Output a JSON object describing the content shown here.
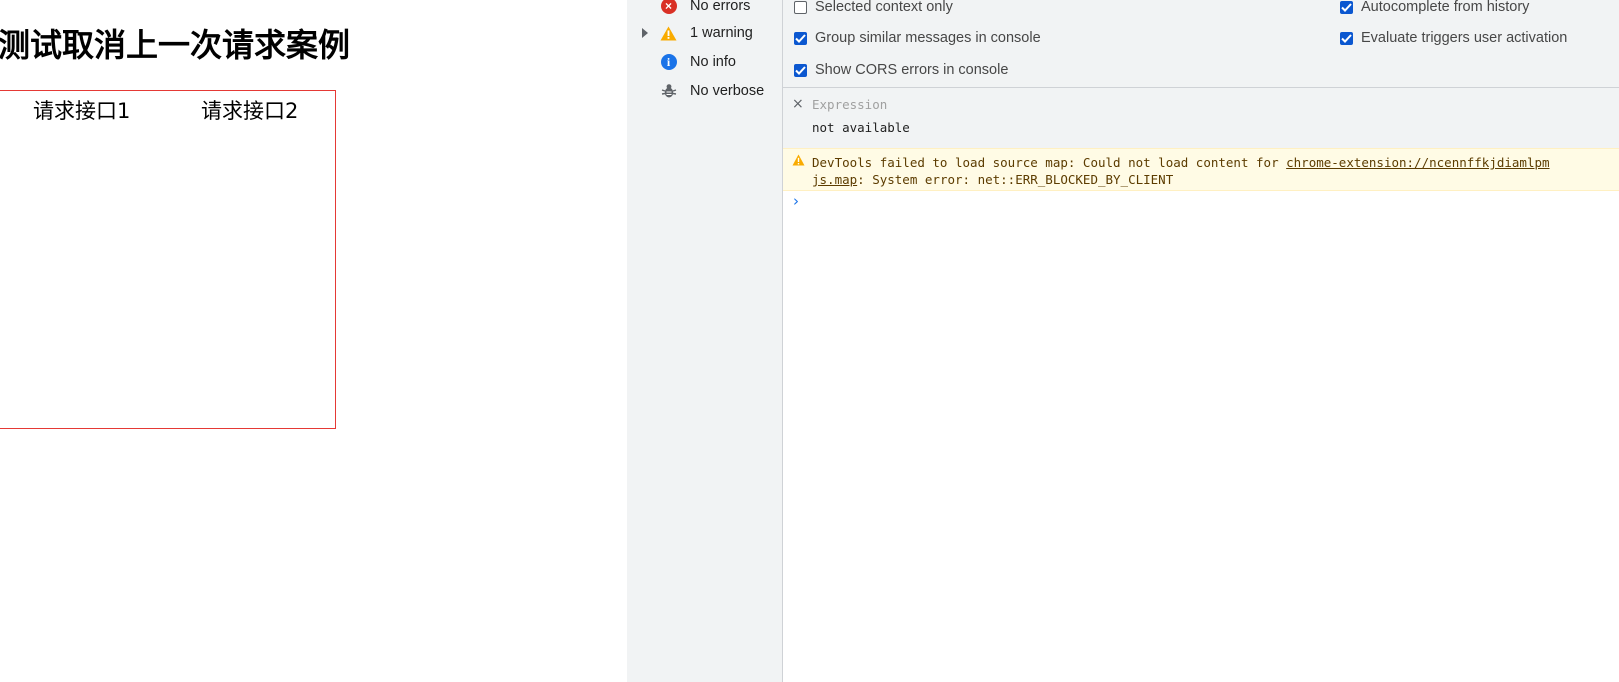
{
  "page": {
    "title": "测试取消上一次请求案例",
    "buttons": [
      "请求接口1",
      "请求接口2"
    ]
  },
  "devtools": {
    "sidebar": [
      {
        "label": "No errors",
        "icon": "error-icon"
      },
      {
        "label": "1 warning",
        "icon": "warning-icon"
      },
      {
        "label": "No info",
        "icon": "info-icon"
      },
      {
        "label": "No verbose",
        "icon": "bug-icon"
      }
    ],
    "settings": [
      {
        "label": "Selected context only",
        "checked": false
      },
      {
        "label": "Group similar messages in console",
        "checked": true
      },
      {
        "label": "Show CORS errors in console",
        "checked": true
      },
      {
        "label": "Autocomplete from history",
        "checked": true
      },
      {
        "label": "Evaluate triggers user activation",
        "checked": true
      }
    ],
    "expression": {
      "placeholder": "Expression",
      "value": "not available"
    },
    "warning": {
      "line1_text": "DevTools failed to load source map: Could not load content for ",
      "line1_link": "chrome-extension://ncennffkjdiamlpm",
      "line2_link": "js.map",
      "line2_text": ": System error: net::ERR_BLOCKED_BY_CLIENT"
    },
    "prompt_glyph": "›",
    "colors": {
      "error": "#d93025",
      "warning": "#f9ab00",
      "info": "#1a73e8",
      "checkbox": "#0b57d0"
    }
  }
}
